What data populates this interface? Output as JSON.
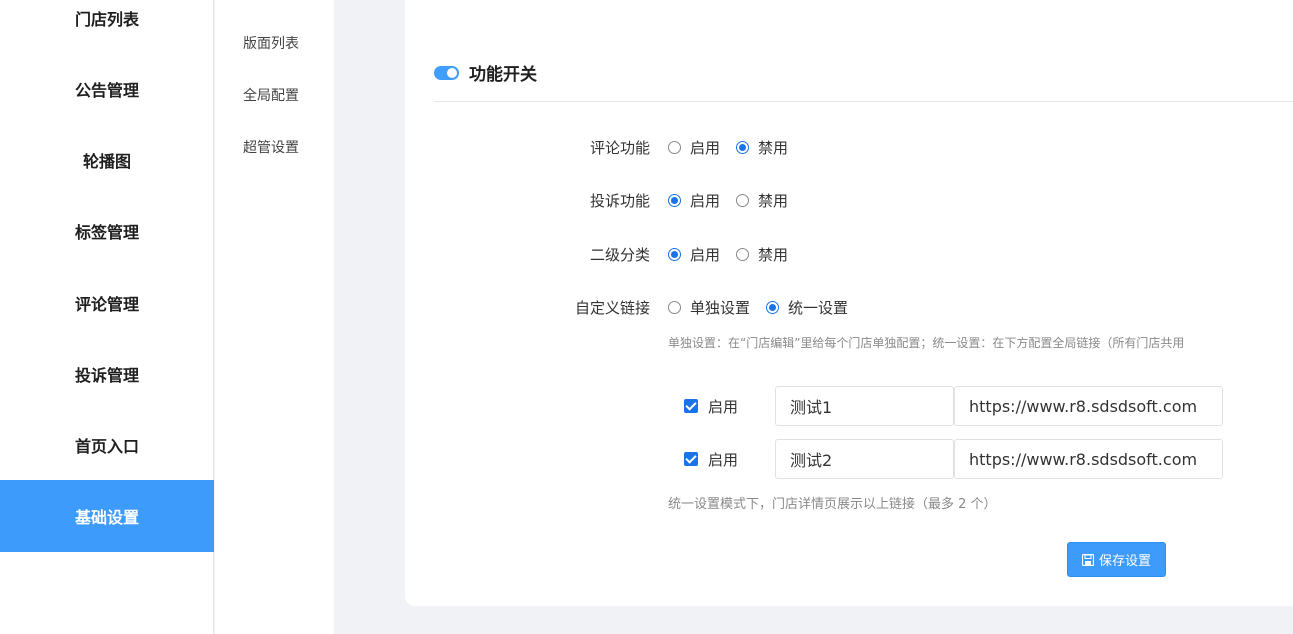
{
  "sidebar": {
    "items": [
      {
        "label": "门店列表",
        "active": false
      },
      {
        "label": "公告管理",
        "active": false
      },
      {
        "label": "轮播图",
        "active": false
      },
      {
        "label": "标签管理",
        "active": false
      },
      {
        "label": "评论管理",
        "active": false
      },
      {
        "label": "投诉管理",
        "active": false
      },
      {
        "label": "首页入口",
        "active": false
      },
      {
        "label": "基础设置",
        "active": true
      }
    ]
  },
  "submenu": {
    "items": [
      {
        "label": "版面列表"
      },
      {
        "label": "全局配置"
      },
      {
        "label": "超管设置"
      }
    ]
  },
  "section": {
    "title": "功能开关",
    "toggle_on": true
  },
  "settings": {
    "comment": {
      "label": "评论功能",
      "option_on": "启用",
      "option_off": "禁用",
      "selected": "禁用"
    },
    "complaint": {
      "label": "投诉功能",
      "option_on": "启用",
      "option_off": "禁用",
      "selected": "启用"
    },
    "subcategory": {
      "label": "二级分类",
      "option_on": "启用",
      "option_off": "禁用",
      "selected": "启用"
    },
    "custom_link": {
      "label": "自定义链接",
      "option_single": "单独设置",
      "option_unified": "统一设置",
      "selected": "统一设置"
    }
  },
  "hint_mode": "单独设置：在“门店编辑”里给每个门店单独配置；统一设置：在下方配置全局链接（所有门店共用",
  "links": [
    {
      "enabled": true,
      "enable_label": "启用",
      "name": "测试1",
      "url": "https://www.r8.sdsdsoft.com"
    },
    {
      "enabled": true,
      "enable_label": "启用",
      "name": "测试2",
      "url": "https://www.r8.sdsdsoft.com"
    }
  ],
  "hint_links": "统一设置模式下，门店详情页展示以上链接（最多 2 个）",
  "save_label": "保存设置",
  "colors": {
    "accent": "#3d9bfb",
    "radio_checked": "#1a73e8"
  }
}
